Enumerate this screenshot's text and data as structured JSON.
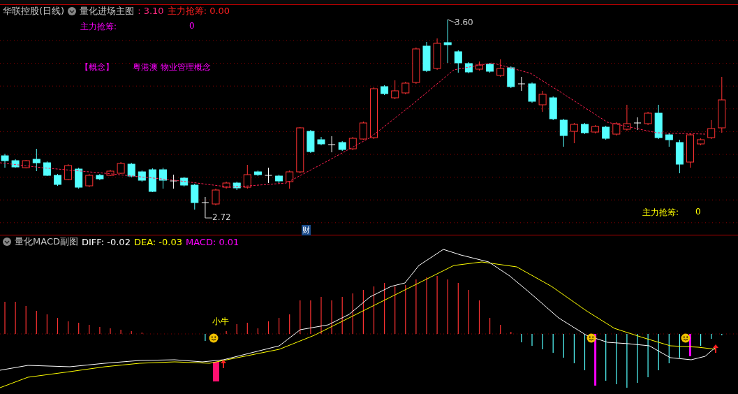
{
  "main_header": {
    "stock": "华联控股(日线)",
    "indicator": "量化进场主图",
    "values": [
      {
        "text": ": 3.10",
        "color": "#ff2a7f"
      },
      {
        "text": "主力抢筹: 0.00",
        "color": "#ff2020"
      }
    ]
  },
  "main_chart": {
    "labels": [
      {
        "kind": "magenta",
        "text": "主力抢筹:",
        "value": "0"
      },
      {
        "kind": "magenta",
        "text": "【概念】",
        "value": "粤港澳 物业管理概念"
      },
      {
        "kind": "yellow",
        "text": "主力抢筹:",
        "value": "0"
      }
    ],
    "high_label": "3.60",
    "low_label": "2.72",
    "badge": "财"
  },
  "sub_header": {
    "indicator": "量化MACD副图",
    "values": [
      {
        "text": "DIFF: -0.02",
        "color": "#ffffff"
      },
      {
        "text": "DEA: -0.03",
        "color": "#ffff00"
      },
      {
        "text": "MACD: 0.01",
        "color": "#ff00ff"
      }
    ]
  },
  "sub_chart": {
    "signal_label": "小牛"
  }
}
